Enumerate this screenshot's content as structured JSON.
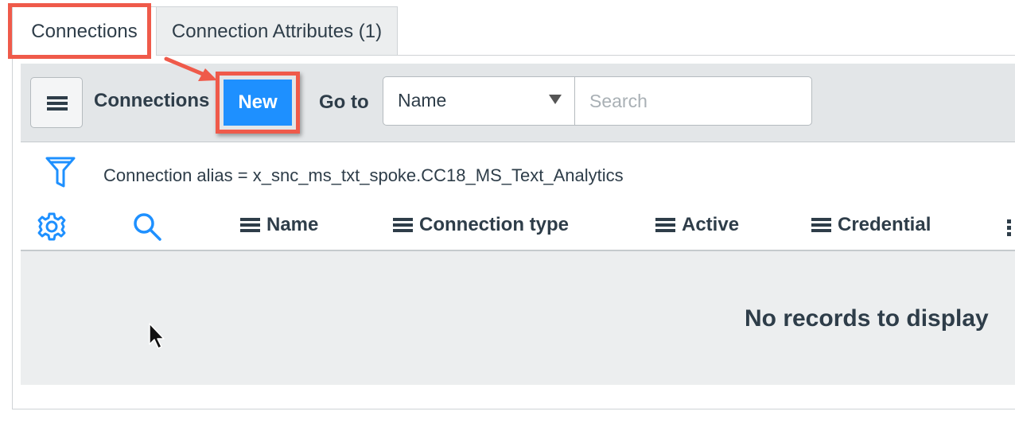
{
  "tabs": [
    {
      "label": "Connections",
      "active": true
    },
    {
      "label": "Connection Attributes (1)",
      "active": false
    }
  ],
  "toolbar": {
    "title": "Connections",
    "new_label": "New",
    "goto_label": "Go to",
    "field_select": {
      "selected": "Name"
    },
    "search": {
      "placeholder": "Search",
      "value": ""
    }
  },
  "filter": {
    "text": "Connection alias = x_snc_ms_txt_spoke.CC18_MS_Text_Analytics"
  },
  "columns": [
    "Name",
    "Connection type",
    "Active",
    "Credential"
  ],
  "list": {
    "empty_message": "No records to display"
  },
  "icons": {
    "menu": "hamburger-menu-icon",
    "filter": "funnel-icon",
    "settings": "gear-icon",
    "search": "magnifier-icon"
  },
  "colors": {
    "primary_button": "#1e90ff",
    "annotation": "#ef5a4a",
    "icon_blue": "#1e90ff",
    "toolbar_bg": "#e3e6e8",
    "text": "#2e3d49"
  }
}
